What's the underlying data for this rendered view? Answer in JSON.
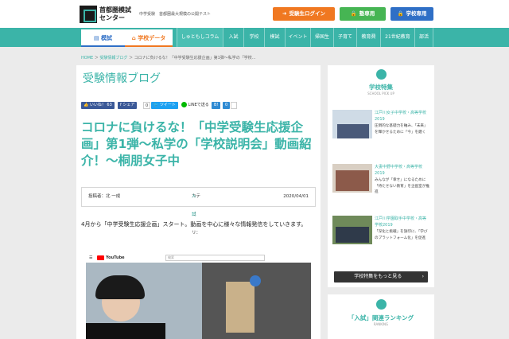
{
  "header": {
    "logo_text": "首都圏模試センター",
    "tagline": "中学受験　首都圏最大規模の公開テスト",
    "buttons": [
      {
        "label": "受験生ログイン",
        "color": "#f07821"
      },
      {
        "label": "塾専用",
        "color": "#46b553"
      },
      {
        "label": "学校専用",
        "color": "#2f6fc6"
      }
    ]
  },
  "nav": {
    "tabs": [
      "模試",
      "学校データ"
    ],
    "links": [
      "しゅともしコラム",
      "入試",
      "学校",
      "模試",
      "イベント",
      "帰国生",
      "子育て",
      "教育費",
      "21世紀教育",
      "部活"
    ]
  },
  "breadcrumb": {
    "home": "HOME",
    "sep": "＞",
    "blog": "受験情報ブログ",
    "current": "コロナに負けるな！「中学受験生応援企画」第1弾〜私学の「学校..."
  },
  "main": {
    "blog_title": "受験情報ブログ",
    "share": {
      "like": "いいね！ 63",
      "fb_share": "シェア",
      "fb_count": "0",
      "tweet": "ツイート",
      "line": "LINEで送る",
      "hatena": "B!",
      "hatena_count": "0"
    },
    "article_title": "コロナに負けるな！「中学受験生応援企画」第1弾〜私学の「学校説明会」動画紹介！〜桐朋女子中",
    "meta": {
      "author": "投稿者：北 一成",
      "category_label": "カテゴリ：",
      "category": "入試",
      "date": "2020/04/01"
    },
    "body": "4月から「中学受験生応援企画」スタート。動画を中心に様々な情報発信をしていきます。",
    "video": {
      "logo": "YouTube",
      "search": "検索"
    }
  },
  "sidebar": {
    "feature": {
      "title": "学校特集",
      "subtitle": "SCHOOL PICK UP",
      "items": [
        {
          "title": "江戸川女子中学校・高等学校2019",
          "desc": "圧倒的な基礎力を軸み、「未来」を輝かせるために「今」を磨く"
        },
        {
          "title": "大妻中野中学校・高等学校2019",
          "desc": "みんなが「幸せ」になるために「待たせない教育」を企画室が推進"
        },
        {
          "title": "江戸川学園取手中学校・高等学校2019",
          "desc": "「深化と挑戦」を旗印に、「学びのプラットフォーム化」を促進"
        }
      ],
      "more": "学校特集をもっと見る"
    },
    "ranking": {
      "title": "「入試」関連ランキング",
      "subtitle": "RANKING"
    }
  }
}
